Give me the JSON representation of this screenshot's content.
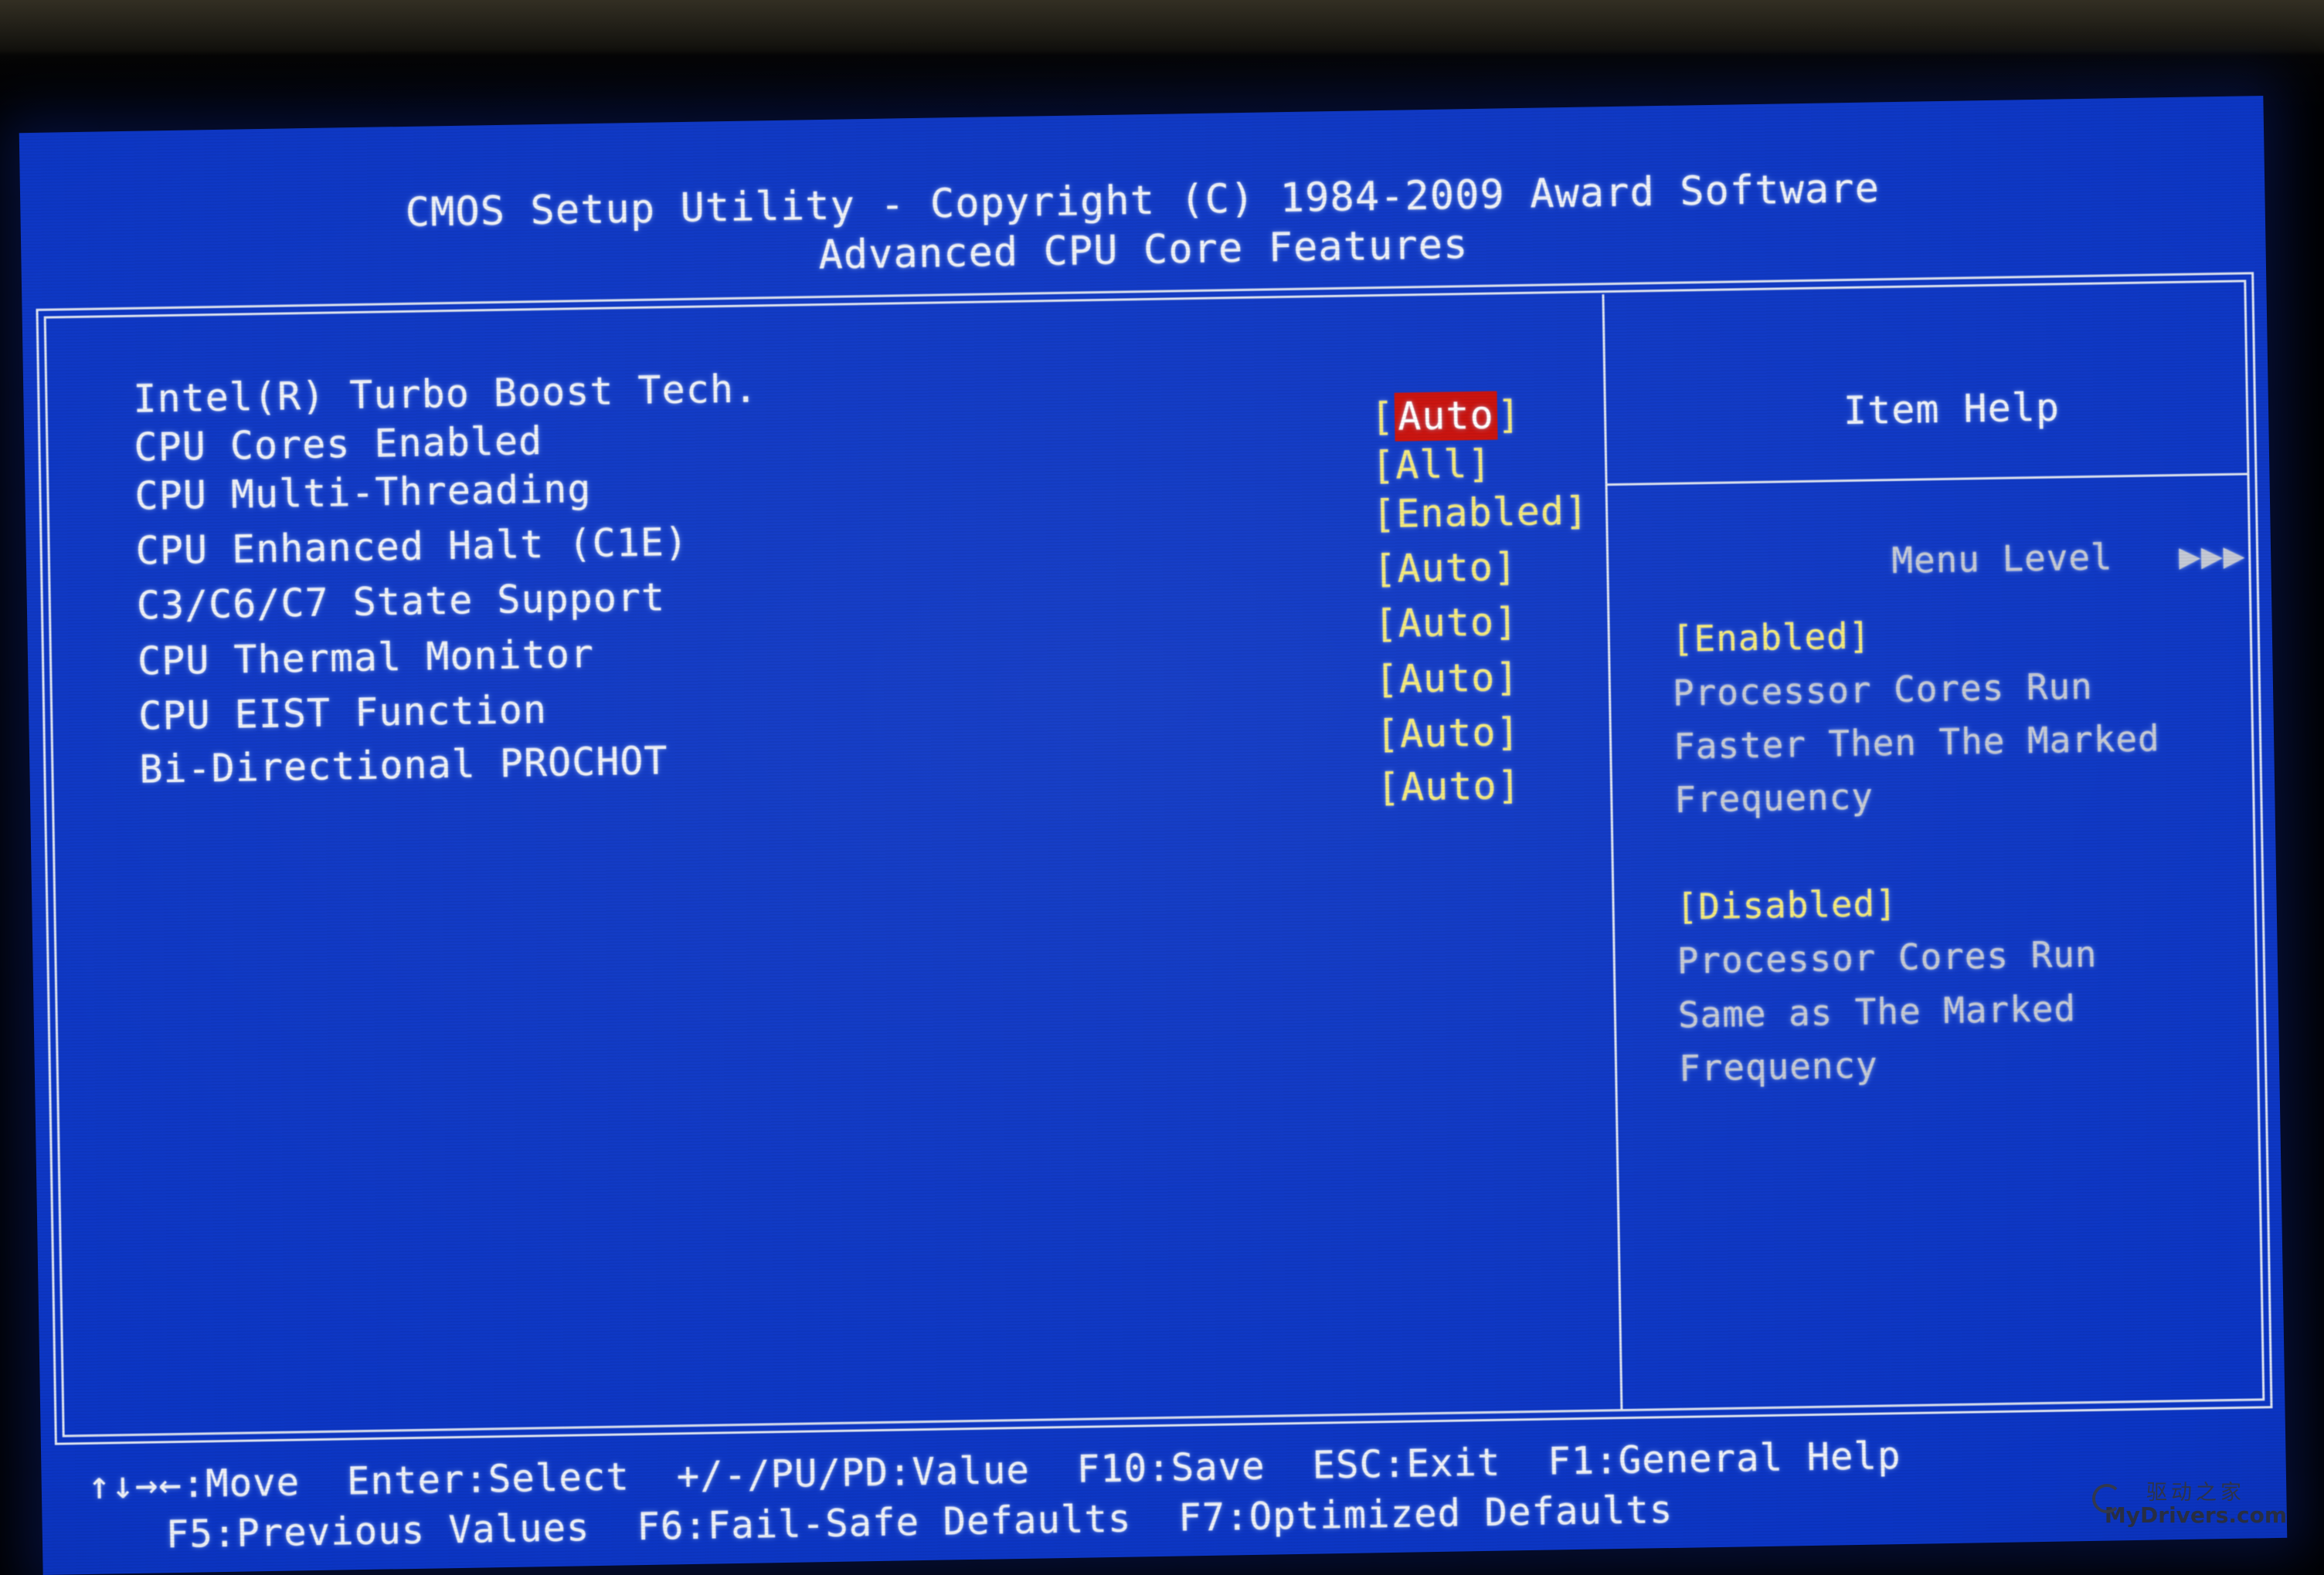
{
  "header": {
    "title_line1": "CMOS Setup Utility - Copyright (C) 1984-2009 Award Software",
    "title_line2": "Advanced CPU Core Features"
  },
  "settings": [
    {
      "label": "Intel(R) Turbo Boost Tech.",
      "value": "Auto",
      "bracket_open": "[",
      "bracket_close": "]",
      "selected": true
    },
    {
      "label": "CPU Cores Enabled",
      "value": "All",
      "bracket_open": "[",
      "bracket_close": "]",
      "selected": false
    },
    {
      "label": "CPU Multi-Threading",
      "value": "Enabled",
      "bracket_open": "[",
      "bracket_close": "]",
      "selected": false
    },
    {
      "label": "CPU Enhanced Halt (C1E)",
      "value": "Auto",
      "bracket_open": "[",
      "bracket_close": "]",
      "selected": false
    },
    {
      "label": "C3/C6/C7 State Support",
      "value": "Auto",
      "bracket_open": "[",
      "bracket_close": "]",
      "selected": false
    },
    {
      "label": "CPU Thermal Monitor",
      "value": "Auto",
      "bracket_open": "[",
      "bracket_close": "]",
      "selected": false
    },
    {
      "label": "CPU EIST Function",
      "value": "Auto",
      "bracket_open": "[",
      "bracket_close": "]",
      "selected": false
    },
    {
      "label": "Bi-Directional PROCHOT",
      "value": "Auto",
      "bracket_open": "[",
      "bracket_close": "]",
      "selected": false
    }
  ],
  "item_help": {
    "title": "Item Help",
    "menu_level_label": "Menu Level",
    "menu_level_arrows": "▶▶▶",
    "blocks": [
      {
        "state": "[Enabled]",
        "lines": [
          "Processor Cores Run",
          "Faster Then The Marked",
          "Frequency"
        ]
      },
      {
        "state": "[Disabled]",
        "lines": [
          "Processor Cores Run",
          "Same as The Marked",
          "Frequency"
        ]
      }
    ]
  },
  "footer": {
    "line1": [
      {
        "keys": "↑↓→←",
        "action": ":Move"
      },
      {
        "keys": "Enter",
        "action": ":Select"
      },
      {
        "keys": "+/-/PU/PD",
        "action": ":Value"
      },
      {
        "keys": "F10",
        "action": ":Save"
      },
      {
        "keys": "ESC",
        "action": ":Exit"
      },
      {
        "keys": "F1",
        "action": ":General Help"
      }
    ],
    "line2": [
      {
        "keys": "F5",
        "action": ":Previous Values"
      },
      {
        "keys": "F6",
        "action": ":Fail-Safe Defaults"
      },
      {
        "keys": "F7",
        "action": ":Optimized Defaults"
      }
    ],
    "line1_text": "↑↓→←:Move  Enter:Select  +/-/PU/PD:Value  F10:Save  ESC:Exit  F1:General Help",
    "line2_text": "F5:Previous Values  F6:Fail-Safe Defaults  F7:Optimized Defaults"
  },
  "watermark": {
    "chinese": "驱动之家",
    "latin": "MyDrivers.com"
  },
  "colors": {
    "screen_blue": "#0b35c4",
    "label_white": "#eef1f8",
    "value_yellow": "#f2e87a",
    "selection_red": "#c90c07",
    "selection_text": "#ffffff",
    "help_grey": "#c3c8d4",
    "border": "#dfe5f2"
  }
}
